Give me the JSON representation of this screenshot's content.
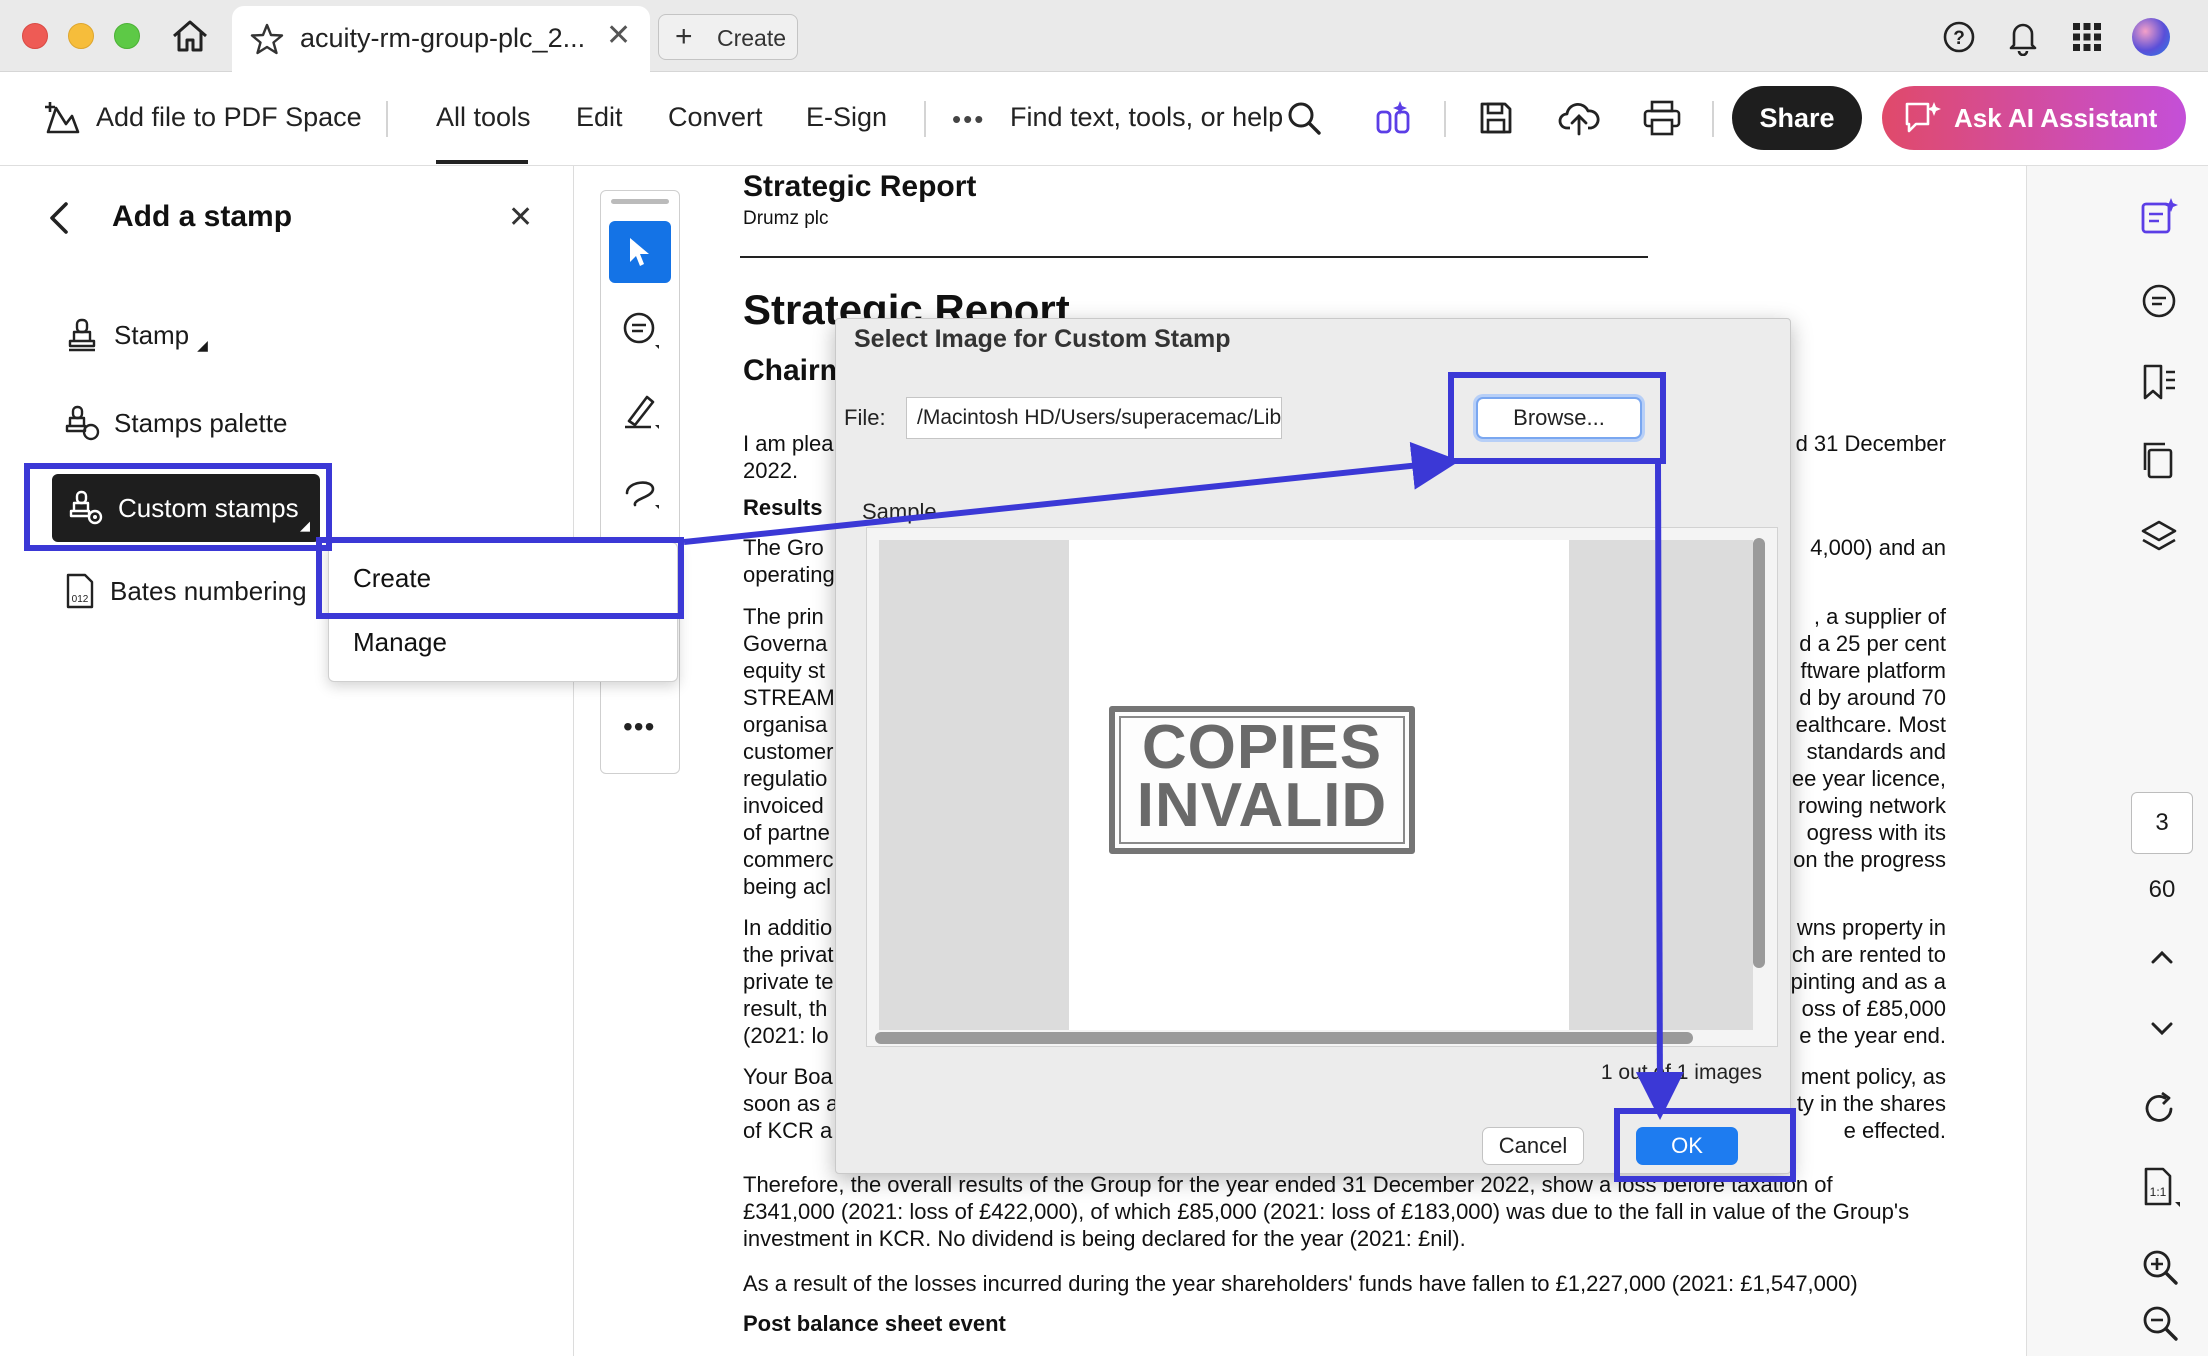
{
  "browser": {
    "tab_title": "acuity-rm-group-plc_2...",
    "create_tab_label": "Create"
  },
  "toolbar": {
    "add_file_label": "Add file to PDF Space",
    "all_tools_label": "All tools",
    "edit_label": "Edit",
    "convert_label": "Convert",
    "esign_label": "E-Sign",
    "search_label": "Find text, tools, or help",
    "share_label": "Share",
    "ai_label": "Ask AI Assistant"
  },
  "left_panel": {
    "title": "Add a stamp",
    "items": [
      {
        "label": "Stamp"
      },
      {
        "label": "Stamps palette"
      },
      {
        "label": "Custom stamps"
      },
      {
        "label": "Bates numbering"
      }
    ]
  },
  "menu": {
    "items": [
      {
        "label": "Create"
      },
      {
        "label": "Manage"
      }
    ]
  },
  "document": {
    "header_title": "Strategic Report",
    "header_subtitle": "Drumz plc",
    "title": "Strategic Report",
    "section_title": "Chairman's Statement",
    "results_heading": "Results",
    "post_balance_heading": "Post balance sheet event",
    "left_lines": [
      "I am plea",
      "2022.",
      "",
      "The Gro",
      "operating",
      "The prin",
      "Governa",
      "equity st",
      "STREAM",
      "organisa",
      "customer",
      "regulatio",
      "invoiced",
      "of  partne",
      "commerc",
      "being acl",
      "In additio",
      "the privat",
      "private te",
      "result,  th",
      "(2021: lo",
      "Your Boa",
      "soon as a",
      "of KCR a"
    ],
    "right_lines": [
      "d 31 December",
      "",
      "",
      "4,000) and an",
      "",
      ", a supplier of",
      "d a 25 per cent",
      "ftware platform",
      "d by around 70",
      "ealthcare. Most",
      " standards and",
      "ee year licence,",
      "rowing network",
      "ogress  with  its",
      "on the progress",
      "",
      "wns property in",
      "ch are rented to",
      "pinting and as a",
      "oss of £85,000",
      "e the year end.",
      "ment policy, as",
      "ty in the shares",
      "e effected."
    ],
    "full_lines": [
      "Therefore, the overall results of the Group for the year ended 31 December 2022, show a loss before taxation of",
      "£341,000 (2021: loss of £422,000), of which £85,000 (2021: loss of £183,000) was due to the fall in value of the Group's",
      "investment in KCR. No dividend is being declared for the year (2021: £nil).",
      "As a result of the losses incurred during the year shareholders' funds have fallen to £1,227,000 (2021: £1,547,000)"
    ]
  },
  "dialog": {
    "title": "Select Image for Custom Stamp",
    "file_label": "File:",
    "file_path": "/Macintosh HD/Users/superacemac/Library/Mobile",
    "browse_label": "Browse...",
    "sample_label": "Sample",
    "stamp_line1": "COPIES",
    "stamp_line2": "INVALID",
    "count_text": "1 out of 1 images",
    "cancel_label": "Cancel",
    "ok_label": "OK"
  },
  "right_rail": {
    "current_page": "3",
    "total_pages": "60"
  },
  "colors": {
    "highlight": "#3b38d6",
    "accent_blue": "#1473e6",
    "ai_gradient_start": "#e04a6a",
    "ai_gradient_end": "#c44fd8"
  }
}
